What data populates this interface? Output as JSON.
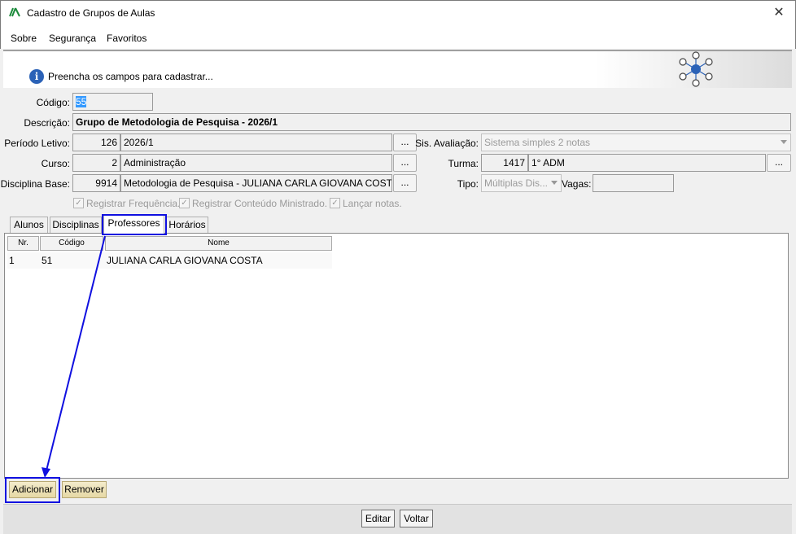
{
  "window": {
    "title": "Cadastro de Grupos de Aulas",
    "close_glyph": "✕"
  },
  "menu": {
    "items": [
      "Sobre",
      "Segurança",
      "Favoritos"
    ]
  },
  "banner": {
    "message": "Preencha os campos para cadastrar..."
  },
  "form": {
    "codigo": {
      "label": "Código:",
      "value": "55"
    },
    "descricao": {
      "label": "Descrição:",
      "value": "Grupo de Metodologia de Pesquisa - 2026/1"
    },
    "periodo": {
      "label": "Período Letivo:",
      "code": "126",
      "value": "2026/1"
    },
    "sis_avaliacao": {
      "label": "Sis. Avaliação:",
      "value": "Sistema simples 2 notas"
    },
    "curso": {
      "label": "Curso:",
      "code": "2",
      "value": "Administração"
    },
    "turma": {
      "label": "Turma:",
      "code": "1417",
      "value": "1° ADM"
    },
    "disciplina": {
      "label": "Disciplina Base:",
      "code": "9914",
      "value": "Metodologia de Pesquisa - JULIANA CARLA GIOVANA COSTA"
    },
    "tipo": {
      "label": "Tipo:",
      "value": "Múltiplas Dis..."
    },
    "vagas": {
      "label": "Vagas:",
      "value": ""
    },
    "dots": "...",
    "checkboxes": [
      {
        "label": "Registrar Frequência.",
        "checked": true
      },
      {
        "label": "Registrar Conteúdo Ministrado.",
        "checked": true
      },
      {
        "label": "Lançar notas.",
        "checked": true
      }
    ]
  },
  "tabs": [
    {
      "label": "Alunos"
    },
    {
      "label": "Disciplinas"
    },
    {
      "label": "Professores",
      "active": true
    },
    {
      "label": "Horários"
    }
  ],
  "table": {
    "headers": [
      "Nr.",
      "Código",
      "Nome"
    ],
    "rows": [
      [
        "1",
        "51",
        "JULIANA CARLA GIOVANA COSTA"
      ]
    ]
  },
  "buttons": {
    "adicionar": "Adicionar",
    "remover": "Remover",
    "editar": "Editar",
    "voltar": "Voltar"
  },
  "colors": {
    "highlight": "#1010e0",
    "accent_yellow": "#e6d9a5",
    "info_blue": "#2b62b7"
  }
}
